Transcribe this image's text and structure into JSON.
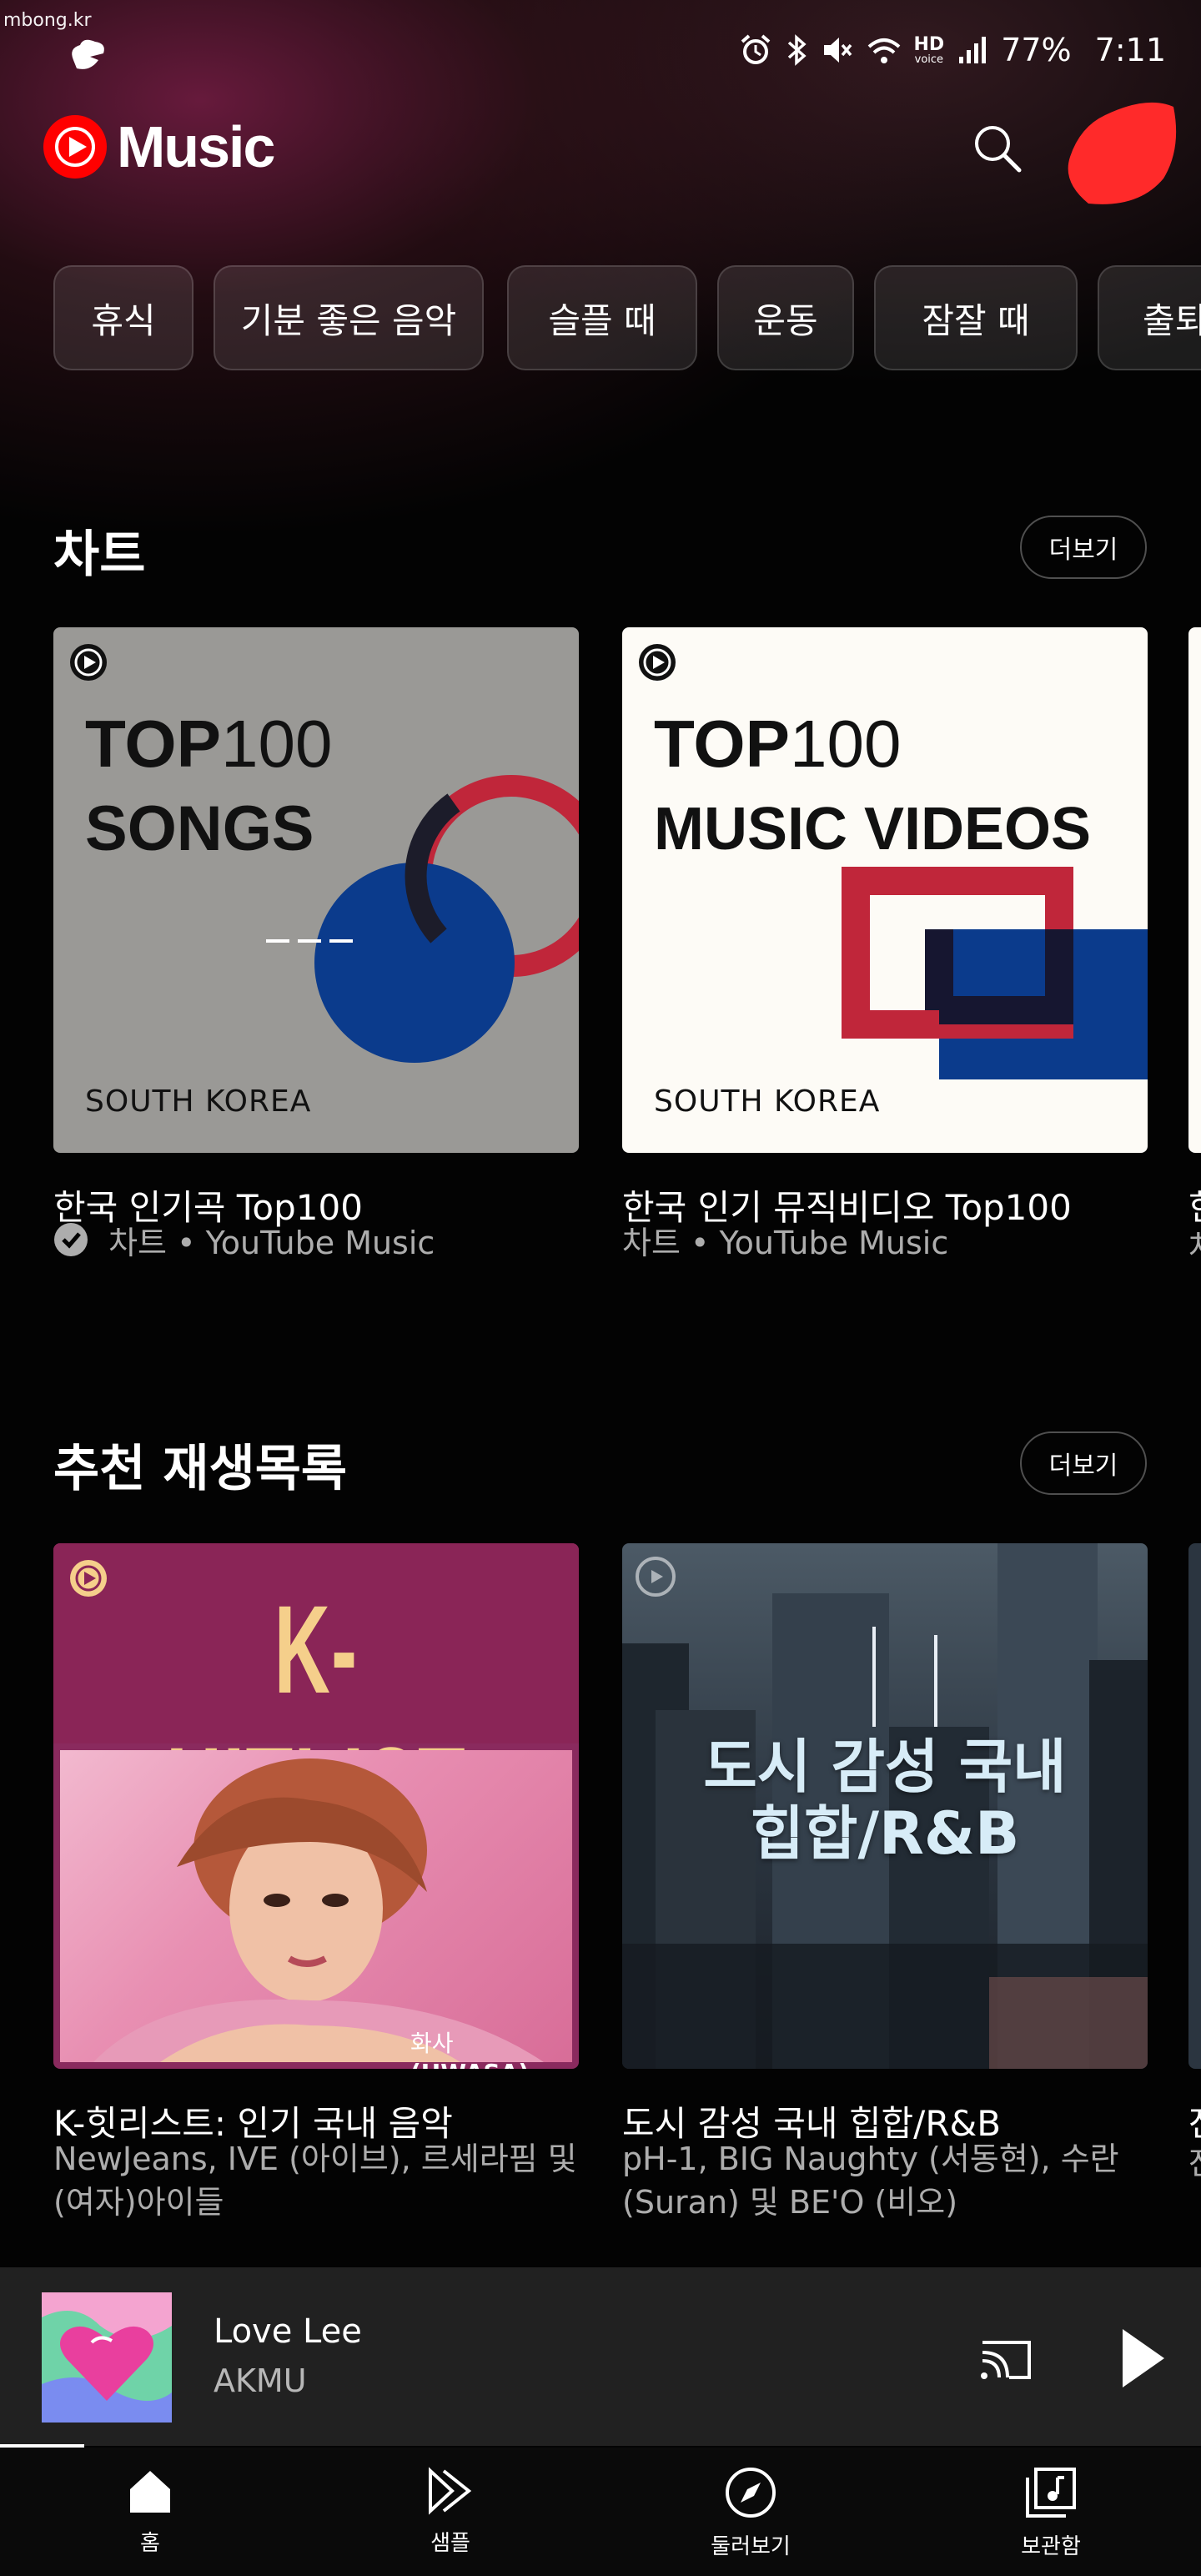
{
  "watermark": "mbong.kr",
  "status_bar": {
    "battery": "77%",
    "time": "7:11",
    "network_badge_top": "HD",
    "network_badge_bottom": "voice"
  },
  "app": {
    "name": "Music",
    "brand_color": "#ff0000"
  },
  "chips": [
    "휴식",
    "기분 좋은 음악",
    "슬플 때",
    "운동",
    "잠잘 때",
    "출퇴"
  ],
  "sections": {
    "charts": {
      "title": "차트",
      "more_label": "더보기",
      "cards": [
        {
          "art_line1_bold": "TOP",
          "art_line1_thin": "100",
          "art_line2": "SONGS",
          "art_region": "SOUTH KOREA",
          "title": "한국 인기곡 Top100",
          "subtitle": "차트 • YouTube Music",
          "verified": true
        },
        {
          "art_line1_bold": "TOP",
          "art_line1_thin": "100",
          "art_line2": "MUSIC VIDEOS",
          "art_region": "SOUTH KOREA",
          "title": "한국 인기 뮤직비디오 Top100",
          "subtitle": "차트 • YouTube Music",
          "verified": false
        }
      ],
      "peek_title": "한",
      "peek_sub": "차"
    },
    "playlists": {
      "title": "추천 재생목록",
      "more_label": "더보기",
      "cards": [
        {
          "art_text": "K-HITLIST",
          "art_caption_ko": "화사",
          "art_caption_en": "(HWASA)",
          "title": "K-힛리스트: 인기 국내 음악",
          "subtitle": "NewJeans, IVE (아이브), 르세라핌 및 (여자)아이들"
        },
        {
          "art_text_line1": "도시 감성 국내",
          "art_text_line2": "힙합/R&B",
          "title": "도시 감성 국내 힙합/R&B",
          "subtitle": "pH-1, BIG Naughty (서동현), 수란(Suran) 및 BE'O (비오)"
        }
      ],
      "peek_title": "잔",
      "peek_sub": "잔"
    }
  },
  "now_playing": {
    "song": "Love Lee",
    "artist": "AKMU",
    "progress": 0.07
  },
  "nav": [
    {
      "label": "홈",
      "icon": "home-icon"
    },
    {
      "label": "샘플",
      "icon": "samples-icon"
    },
    {
      "label": "둘러보기",
      "icon": "explore-icon"
    },
    {
      "label": "보관함",
      "icon": "library-icon"
    }
  ]
}
